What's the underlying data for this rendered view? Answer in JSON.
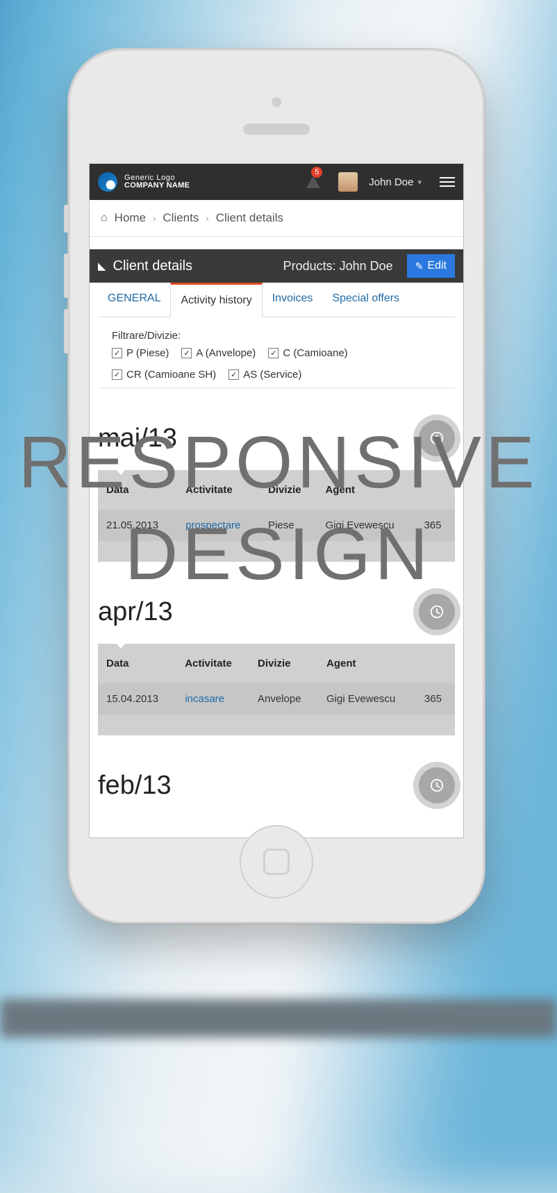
{
  "topbar": {
    "logo_line1": "Generic Logo",
    "logo_line2": "COMPANY NAME",
    "notif_count": "5",
    "username": "John Doe"
  },
  "breadcrumb": {
    "home": "Home",
    "clients": "Clients",
    "details": "Client details"
  },
  "panel": {
    "title": "Client details",
    "subtitle": "Products: John Doe",
    "edit_label": "Edit"
  },
  "tabs": {
    "general": "GENERAL",
    "activity": "Activity history",
    "invoices": "Invoices",
    "offers": "Special offers"
  },
  "filters": {
    "label": "Filtrare/Divizie:",
    "opts": {
      "p": "P (Piese)",
      "a": "A (Anvelope)",
      "c": "C (Camioane)",
      "cr": "CR (Camioane SH)",
      "as": "AS (Service)"
    }
  },
  "columns": {
    "data": "Data",
    "activitate": "Activitate",
    "divizie": "Divizie",
    "agent": "Agent"
  },
  "months": {
    "may": {
      "heading": "mai/13",
      "row": {
        "data": "21.05.2013",
        "act": "prospectare",
        "div": "Piese",
        "agent": "Gigi Evewescu",
        "val": "365"
      }
    },
    "apr": {
      "heading": "apr/13",
      "row": {
        "data": "15.04.2013",
        "act": "incasare",
        "div": "Anvelope",
        "agent": "Gigi Evewescu",
        "val": "365"
      }
    },
    "feb": {
      "heading": "feb/13"
    }
  },
  "watermark": {
    "l1": "RESPONSIVE",
    "l2": "DESIGN"
  }
}
